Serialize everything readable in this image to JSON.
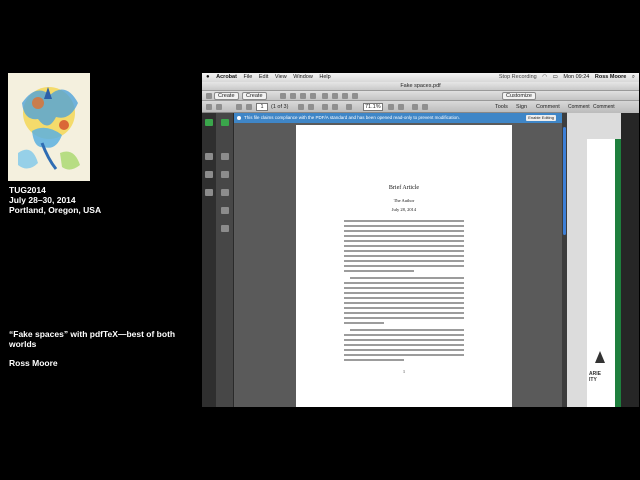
{
  "conference": {
    "name": "TUG2014",
    "dates": "July 28–30, 2014",
    "location": "Portland, Oregon, USA"
  },
  "talk": {
    "title": "“Fake spaces” with pdfTeX—best of both worlds",
    "speaker": "Ross Moore"
  },
  "app": {
    "menubar": {
      "app_name": "Acrobat",
      "items": [
        "File",
        "Edit",
        "View",
        "Window",
        "Help"
      ],
      "recording": "Stop Recording",
      "clock": "Mon 09:24",
      "user": "Ross Moore"
    },
    "window_title": "Fake spaces.pdf",
    "toolbar1": {
      "create": "Create",
      "customize": "Customize"
    },
    "toolbar2": {
      "page_current": "1",
      "page_of": "(1 of 3)",
      "zoom": "71.1%",
      "tools": "Tools",
      "sign": "Sign",
      "comment": "Comment"
    },
    "infobar": {
      "message": "This file claims compliance with the PDF/A standard and has been opened read-only to prevent modification.",
      "button": "Enable Editing"
    }
  },
  "document": {
    "title": "Brief Article",
    "author": "The Author",
    "date": "July 28, 2014",
    "page_number": "1"
  },
  "behind_window": {
    "labels": [
      "Comment",
      "Comment"
    ],
    "logo_text_lines": [
      "ARIE",
      "ITY"
    ]
  },
  "colors": {
    "background": "#000000",
    "infobar": "#3f86c7",
    "scroll_thumb": "#3d7fd6",
    "page": "#ffffff"
  }
}
